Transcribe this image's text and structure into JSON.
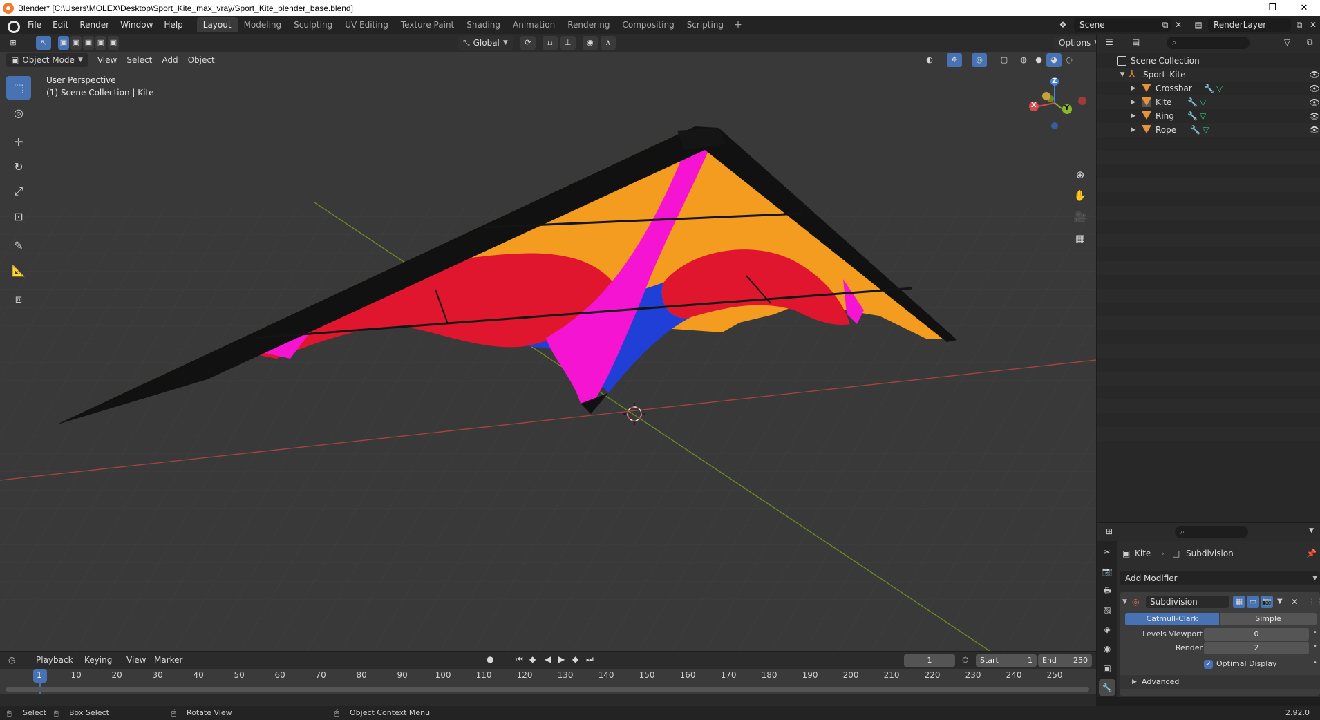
{
  "window": {
    "title": "Blender* [C:\\Users\\MOLEX\\Desktop\\Sport_Kite_max_vray/Sport_Kite_blender_base.blend]",
    "min_glyph": "—",
    "max_glyph": "❐",
    "close_glyph": "✕"
  },
  "menu": {
    "items": [
      "File",
      "Edit",
      "Render",
      "Window",
      "Help"
    ]
  },
  "workspaces": {
    "tabs": [
      "Layout",
      "Modeling",
      "Sculpting",
      "UV Editing",
      "Texture Paint",
      "Shading",
      "Animation",
      "Rendering",
      "Compositing",
      "Scripting"
    ],
    "active": "Layout",
    "add_glyph": "+"
  },
  "scene": {
    "scene_name": "Scene",
    "render_layer": "RenderLayer"
  },
  "viewport": {
    "transform_orientation": "Global",
    "options_label": "Options",
    "mode": "Object Mode",
    "menus": [
      "View",
      "Select",
      "Add",
      "Object"
    ],
    "perspective_label": "User Perspective",
    "collection_label": "(1) Scene Collection | Kite"
  },
  "gizmo": {
    "x": "X",
    "y": "Y",
    "z": "Z"
  },
  "outliner": {
    "root": "Scene Collection",
    "collection": "Sport_Kite",
    "objects": [
      "Crossbar",
      "Kite",
      "Ring",
      "Rope"
    ]
  },
  "properties": {
    "object_name": "Kite",
    "modifier_name": "Subdivision",
    "add_modifier_label": "Add Modifier",
    "panel_title": "Subdivision",
    "type_options": [
      "Catmull-Clark",
      "Simple"
    ],
    "active_type": "Catmull-Clark",
    "levels_viewport_label": "Levels Viewport",
    "levels_viewport_value": "0",
    "render_label": "Render",
    "render_value": "2",
    "optimal_display_label": "Optimal Display",
    "optimal_display_checked": true,
    "advanced_label": "Advanced"
  },
  "timeline": {
    "menus": [
      "Playback",
      "Keying",
      "View",
      "Marker"
    ],
    "current_frame": "1",
    "start_label": "Start",
    "start_value": "1",
    "end_label": "End",
    "end_value": "250",
    "ticks": [
      "1",
      "10",
      "20",
      "30",
      "40",
      "50",
      "60",
      "70",
      "80",
      "90",
      "100",
      "110",
      "120",
      "130",
      "140",
      "150",
      "160",
      "170",
      "180",
      "190",
      "200",
      "210",
      "220",
      "230",
      "240",
      "250"
    ]
  },
  "statusbar": {
    "select": "Select",
    "box_select": "Box Select",
    "rotate_view": "Rotate View",
    "context_menu": "Object Context Menu",
    "version": "2.92.0"
  },
  "colors": {
    "accent": "#4772b3",
    "kite_orange": "#f39c1f",
    "kite_red": "#e0162f",
    "kite_magenta": "#f514d2",
    "kite_blue": "#1f3fd6",
    "axis_x": "#b34848",
    "axis_y": "#7a9a2a"
  }
}
